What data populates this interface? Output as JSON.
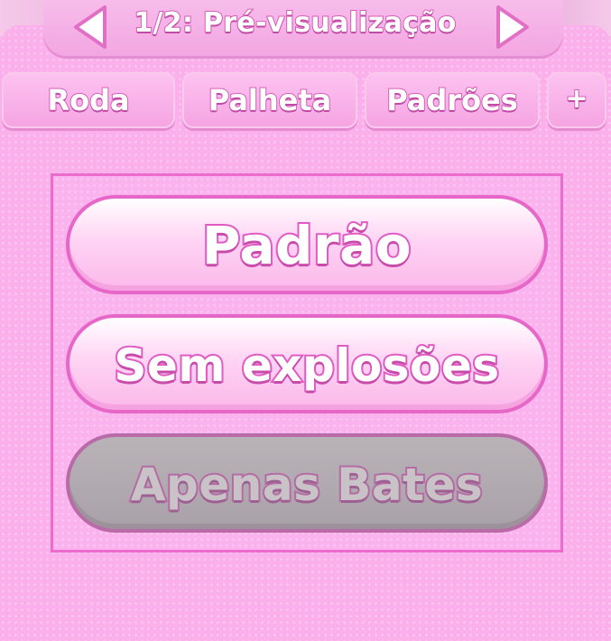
{
  "header": {
    "title": "1/2: Pré-visualização",
    "prev_icon": "arrow-left-icon",
    "next_icon": "arrow-right-icon"
  },
  "tabs": [
    {
      "label": "Roda"
    },
    {
      "label": "Palheta"
    },
    {
      "label": "Padrões"
    },
    {
      "label": "+"
    }
  ],
  "modes": [
    {
      "label": "Padrão",
      "state": "enabled"
    },
    {
      "label": "Sem explosões",
      "state": "enabled"
    },
    {
      "label": "Apenas Bates",
      "state": "disabled"
    }
  ],
  "colors": {
    "panel": "#fbb0ec",
    "accent": "#e767c9",
    "button_text": "#ffffff",
    "disabled_button": "#aaa3a9"
  }
}
